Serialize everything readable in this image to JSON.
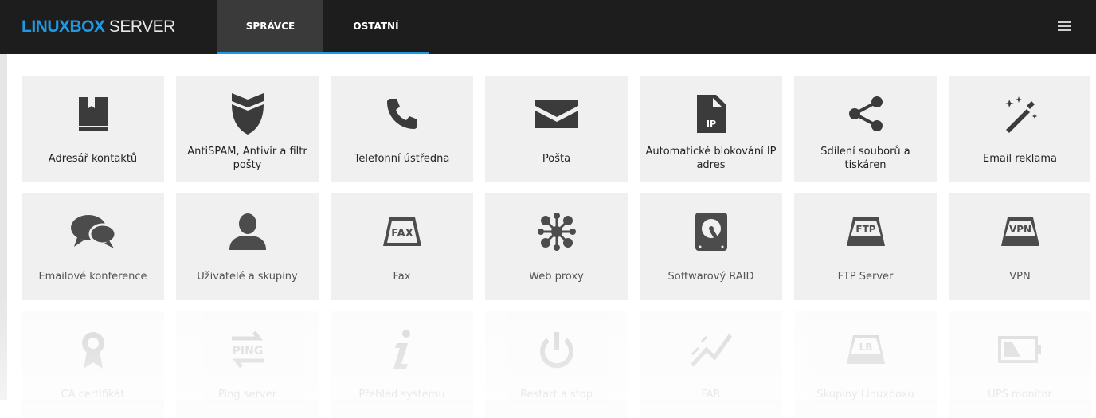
{
  "header": {
    "brand_part1": "LINUXBOX",
    "brand_part2": " SERVER",
    "tabs": [
      {
        "label": "SPRÁVCE"
      },
      {
        "label": "OSTATNÍ"
      }
    ]
  },
  "colors": {
    "accent": "#1e9ae4",
    "topbar": "#1d1d1d",
    "tile": "#f0f0f0"
  },
  "tiles": [
    {
      "label": "Adresář kontaktů",
      "icon": "address-book-icon"
    },
    {
      "label": "AntiSPAM, Antivir a filtr pošty",
      "icon": "shield-icon"
    },
    {
      "label": "Telefonní ústředna",
      "icon": "phone-icon"
    },
    {
      "label": "Pošta",
      "icon": "envelope-icon"
    },
    {
      "label": "Automatické blokování IP adres",
      "icon": "ip-file-icon"
    },
    {
      "label": "Sdílení souborů a tiskáren",
      "icon": "share-icon"
    },
    {
      "label": "Email reklama",
      "icon": "magic-wand-icon"
    },
    {
      "label": "Emailové konference",
      "icon": "chat-bubbles-icon"
    },
    {
      "label": "Uživatelé a skupiny",
      "icon": "user-icon"
    },
    {
      "label": "Fax",
      "icon": "fax-drive-icon"
    },
    {
      "label": "Web proxy",
      "icon": "network-icon"
    },
    {
      "label": "Softwarový RAID",
      "icon": "hard-disk-icon"
    },
    {
      "label": "FTP Server",
      "icon": "ftp-drive-icon"
    },
    {
      "label": "VPN",
      "icon": "vpn-drive-icon"
    },
    {
      "label": "CA certifikát",
      "icon": "certificate-icon"
    },
    {
      "label": "Ping server",
      "icon": "ping-icon"
    },
    {
      "label": "Přehled systému",
      "icon": "info-icon"
    },
    {
      "label": "Restart a stop",
      "icon": "power-icon"
    },
    {
      "label": "FAR",
      "icon": "chart-line-icon"
    },
    {
      "label": "Skupiny Linuxboxu",
      "icon": "lb-drive-icon"
    },
    {
      "label": "UPS monitor",
      "icon": "battery-icon"
    }
  ]
}
